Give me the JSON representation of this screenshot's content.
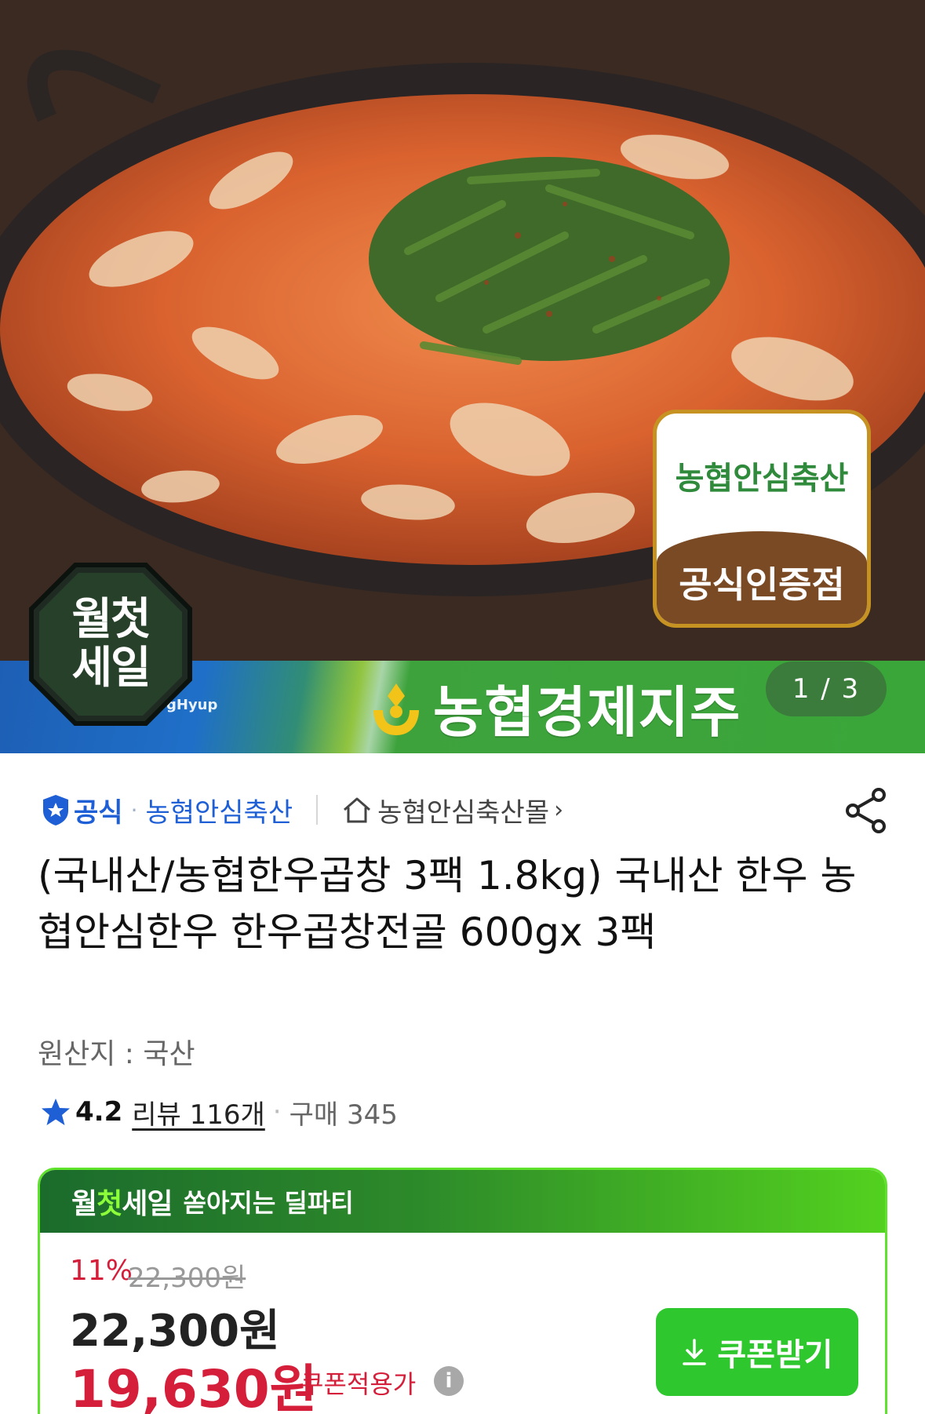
{
  "hero": {
    "cert_badge_top": "농협안심축산",
    "cert_badge_bottom": "공식인증점",
    "sale_emblem_line1": "월첫",
    "sale_emblem_line2": "세일",
    "banner_small_text": "gHyup",
    "banner_brand": "농협경제지주",
    "page_indicator": "1 / 3",
    "banner_colors": {
      "blue": "#1f6fc8",
      "green": "#3aa63a"
    }
  },
  "seller": {
    "official_label": "공식",
    "separator": "·",
    "seller_name": "농협안심축산",
    "mall_link": "농협안심축산몰",
    "mall_chevron": "›"
  },
  "product": {
    "title": "(국내산/농협한우곱창 3팩 1.8kg) 국내산 한우 농협안심한우 한우곱창전골 600gx 3팩",
    "origin": "원산지 : 국산",
    "rating": "4.2",
    "review_label": "리뷰 116개",
    "separator": "·",
    "purchase_label": "구매 345"
  },
  "deal": {
    "logo_prefix": "월",
    "logo_highlight": "첫",
    "logo_suffix": "세일",
    "subtitle": "쏟아지는 딜파티",
    "discount_rate": "11%",
    "original_price": "22,300원",
    "price": "22,300원",
    "coupon_price": "19,630원",
    "coupon_label": "쿠폰적용가",
    "info_glyph": "i",
    "coupon_button": "쿠폰받기",
    "accent_color": "#d51e3a",
    "button_color": "#2ec72e"
  }
}
